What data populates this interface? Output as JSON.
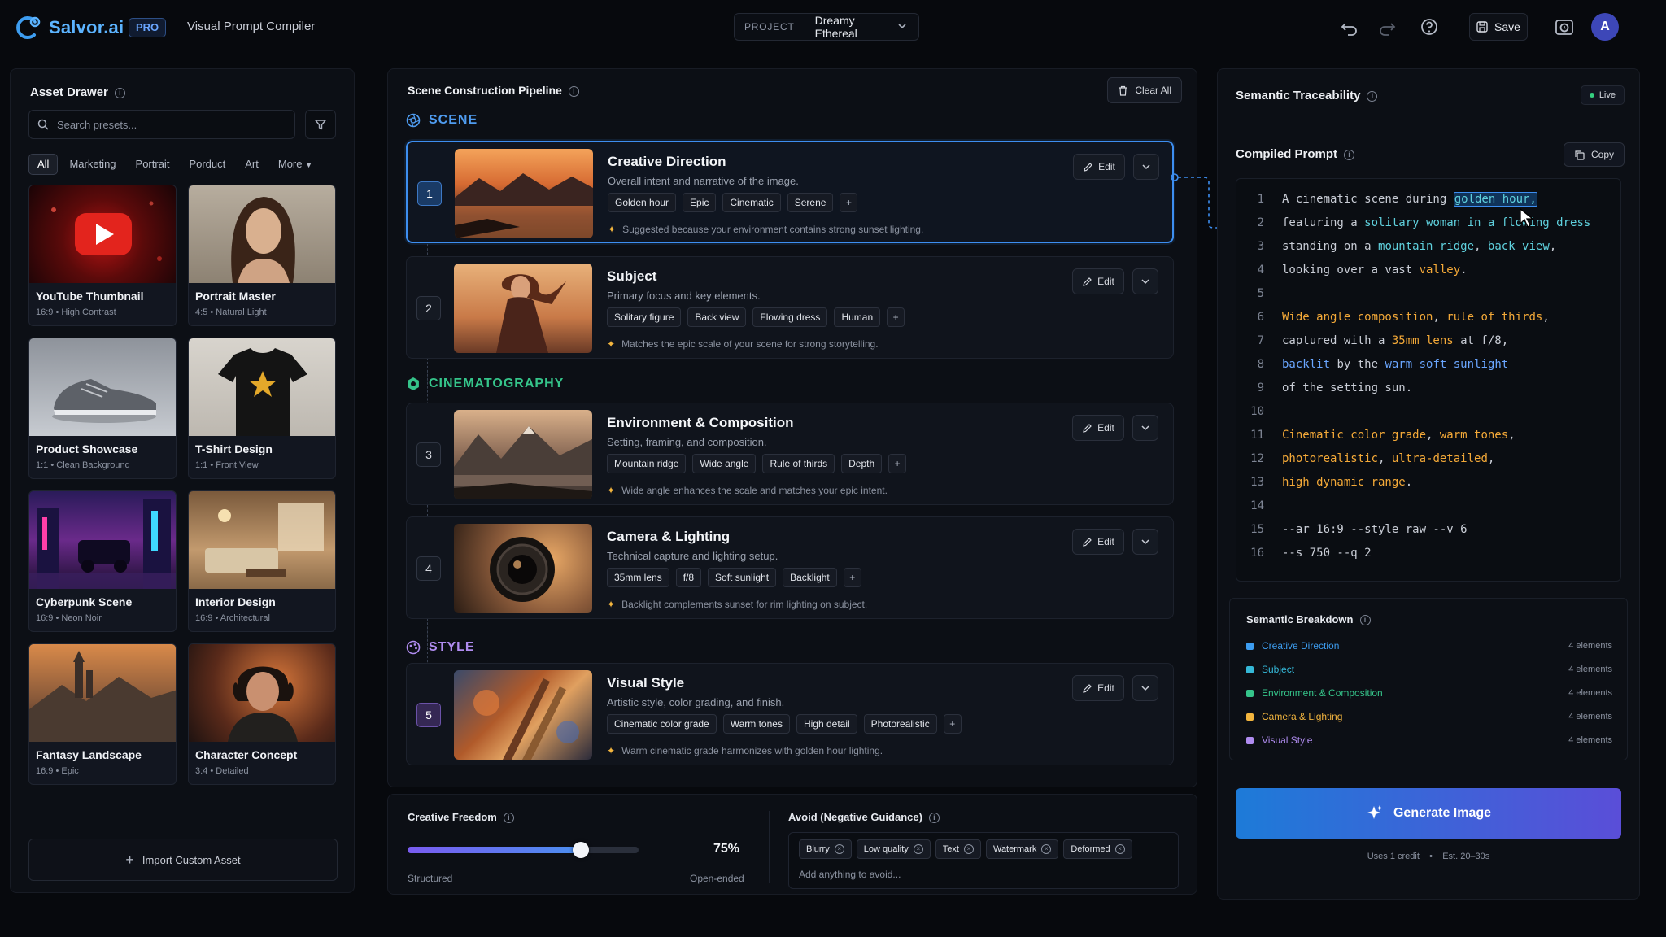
{
  "app": {
    "name": "Salvor.ai",
    "badge": "PRO",
    "subtitle": "Visual Prompt Compiler",
    "project_label": "PROJECT",
    "project_name": "Dreamy Ethereal",
    "save_label": "Save",
    "avatar_initial": "A"
  },
  "asset_drawer": {
    "title": "Asset Drawer",
    "search_placeholder": "Search presets...",
    "filters": [
      "All",
      "Marketing",
      "Portrait",
      "Porduct",
      "Art",
      "More"
    ],
    "assets": [
      {
        "name": "YouTube Thumbnail",
        "meta": "16:9  •  High Contrast",
        "theme": "youtube"
      },
      {
        "name": "Portrait Master",
        "meta": "4:5  •  Natural Light",
        "theme": "portrait"
      },
      {
        "name": "Product Showcase",
        "meta": "1:1  •  Clean Background",
        "theme": "product"
      },
      {
        "name": "T-Shirt Design",
        "meta": "1:1  •  Front View",
        "theme": "tshirt"
      },
      {
        "name": "Cyberpunk Scene",
        "meta": "16:9  •  Neon Noir",
        "theme": "cyberpunk"
      },
      {
        "name": "Interior Design",
        "meta": "16:9  •  Architectural",
        "theme": "interior"
      },
      {
        "name": "Fantasy Landscape",
        "meta": "16:9  •  Epic",
        "theme": "fantasy"
      },
      {
        "name": "Character Concept",
        "meta": "3:4  •  Detailed",
        "theme": "character"
      }
    ],
    "import_label": "Import Custom Asset"
  },
  "pipeline": {
    "title": "Scene Construction Pipeline",
    "clear_label": "Clear All",
    "edit_label": "Edit",
    "sections": [
      {
        "label": "SCENE",
        "color": "#4f9cf0"
      },
      {
        "label": "CINEMATOGRAPHY",
        "color": "#35c48a"
      },
      {
        "label": "STYLE",
        "color": "#b08cf0"
      }
    ],
    "steps": [
      {
        "num": "1",
        "title": "Creative Direction",
        "desc": "Overall intent and narrative of the image.",
        "tags": [
          "Golden hour",
          "Epic",
          "Cinematic",
          "Serene"
        ],
        "hint": "Suggested because your environment contains strong sunset lighting.",
        "theme": "sunset-lake"
      },
      {
        "num": "2",
        "title": "Subject",
        "desc": "Primary focus and key elements.",
        "tags": [
          "Solitary figure",
          "Back view",
          "Flowing dress",
          "Human"
        ],
        "hint": "Matches the epic scale of your scene for strong storytelling.",
        "theme": "woman"
      },
      {
        "num": "3",
        "title": "Environment & Composition",
        "desc": "Setting, framing, and composition.",
        "tags": [
          "Mountain ridge",
          "Wide angle",
          "Rule of thirds",
          "Depth"
        ],
        "hint": "Wide angle enhances the scale and matches your epic intent.",
        "theme": "mountain"
      },
      {
        "num": "4",
        "title": "Camera & Lighting",
        "desc": "Technical capture and lighting setup.",
        "tags": [
          "35mm lens",
          "f/8",
          "Soft sunlight",
          "Backlight"
        ],
        "hint": "Backlight complements sunset for rim lighting on subject.",
        "theme": "lens"
      },
      {
        "num": "5",
        "title": "Visual Style",
        "desc": "Artistic style, color grading, and finish.",
        "tags": [
          "Cinematic color grade",
          "Warm tones",
          "High detail",
          "Photorealistic"
        ],
        "hint": "Warm cinematic grade harmonizes with golden hour lighting.",
        "theme": "paint"
      }
    ],
    "add_tag": "+"
  },
  "freedom": {
    "title": "Creative Freedom",
    "value": 0.75,
    "value_label": "75%",
    "min_label": "Structured",
    "max_label": "Open-ended"
  },
  "avoid": {
    "title": "Avoid (Negative Guidance)",
    "tags": [
      "Blurry",
      "Low quality",
      "Text",
      "Watermark",
      "Deformed"
    ],
    "placeholder": "Add anything to avoid..."
  },
  "traceability": {
    "title": "Semantic Traceability",
    "live_label": "Live",
    "compiled_title": "Compiled Prompt",
    "copy_label": "Copy",
    "code_lines": [
      {
        "n": "1",
        "segs": [
          {
            "t": "A cinematic scene during ",
            "c": "c-gray"
          },
          {
            "t": "golden hour,",
            "c": "c-cyan hl"
          }
        ]
      },
      {
        "n": "2",
        "segs": [
          {
            "t": "featuring a ",
            "c": "c-gray"
          },
          {
            "t": "solitary woman in a flowing dress",
            "c": "c-cyan"
          }
        ]
      },
      {
        "n": "3",
        "segs": [
          {
            "t": "standing on a ",
            "c": "c-gray"
          },
          {
            "t": "mountain ridge",
            "c": "c-cyan"
          },
          {
            "t": ", ",
            "c": "c-gray"
          },
          {
            "t": "back view",
            "c": "c-cyan"
          },
          {
            "t": ",",
            "c": "c-gray"
          }
        ]
      },
      {
        "n": "4",
        "segs": [
          {
            "t": "looking over a vast ",
            "c": "c-gray"
          },
          {
            "t": "valley",
            "c": "c-orange"
          },
          {
            "t": ".",
            "c": "c-gray"
          }
        ]
      },
      {
        "n": "5",
        "segs": []
      },
      {
        "n": "6",
        "segs": [
          {
            "t": "Wide angle composition",
            "c": "c-orange"
          },
          {
            "t": ", ",
            "c": "c-gray"
          },
          {
            "t": "rule of thirds",
            "c": "c-orange"
          },
          {
            "t": ",",
            "c": "c-gray"
          }
        ]
      },
      {
        "n": "7",
        "segs": [
          {
            "t": "captured with a ",
            "c": "c-gray"
          },
          {
            "t": "35mm lens",
            "c": "c-orange"
          },
          {
            "t": " at f/8,",
            "c": "c-gray"
          }
        ]
      },
      {
        "n": "8",
        "segs": [
          {
            "t": "backlit",
            "c": "c-blue"
          },
          {
            "t": " by the ",
            "c": "c-gray"
          },
          {
            "t": "warm soft sunlight",
            "c": "c-blue"
          }
        ]
      },
      {
        "n": "9",
        "segs": [
          {
            "t": "of the setting sun.",
            "c": "c-gray"
          }
        ]
      },
      {
        "n": "10",
        "segs": []
      },
      {
        "n": "11",
        "segs": [
          {
            "t": "Cinematic color grade",
            "c": "c-orange"
          },
          {
            "t": ", ",
            "c": "c-gray"
          },
          {
            "t": "warm tones",
            "c": "c-orange"
          },
          {
            "t": ",",
            "c": "c-gray"
          }
        ]
      },
      {
        "n": "12",
        "segs": [
          {
            "t": "photorealistic",
            "c": "c-orange"
          },
          {
            "t": ", ",
            "c": "c-gray"
          },
          {
            "t": "ultra-detailed",
            "c": "c-orange"
          },
          {
            "t": ",",
            "c": "c-gray"
          }
        ]
      },
      {
        "n": "13",
        "segs": [
          {
            "t": "high dynamic range",
            "c": "c-orange"
          },
          {
            "t": ".",
            "c": "c-gray"
          }
        ]
      },
      {
        "n": "14",
        "segs": []
      },
      {
        "n": "15",
        "segs": [
          {
            "t": "--ar 16:9 --style raw --v 6",
            "c": "c-gray"
          }
        ]
      },
      {
        "n": "16",
        "segs": [
          {
            "t": "--s 750 --q 2",
            "c": "c-gray"
          }
        ]
      }
    ],
    "breakdown_title": "Semantic Breakdown",
    "breakdown": [
      {
        "name": "Creative Direction",
        "count": "4 elements",
        "color": "#3d9df0"
      },
      {
        "name": "Subject",
        "count": "4 elements",
        "color": "#35b8d8"
      },
      {
        "name": "Environment & Composition",
        "count": "4 elements",
        "color": "#35c48a"
      },
      {
        "name": "Camera & Lighting",
        "count": "4 elements",
        "color": "#f3b53e"
      },
      {
        "name": "Visual Style",
        "count": "4 elements",
        "color": "#b08cf0"
      }
    ],
    "generate_label": "Generate Image",
    "generate_meta": "Uses 1 credit    •    Est. 20–30s"
  }
}
